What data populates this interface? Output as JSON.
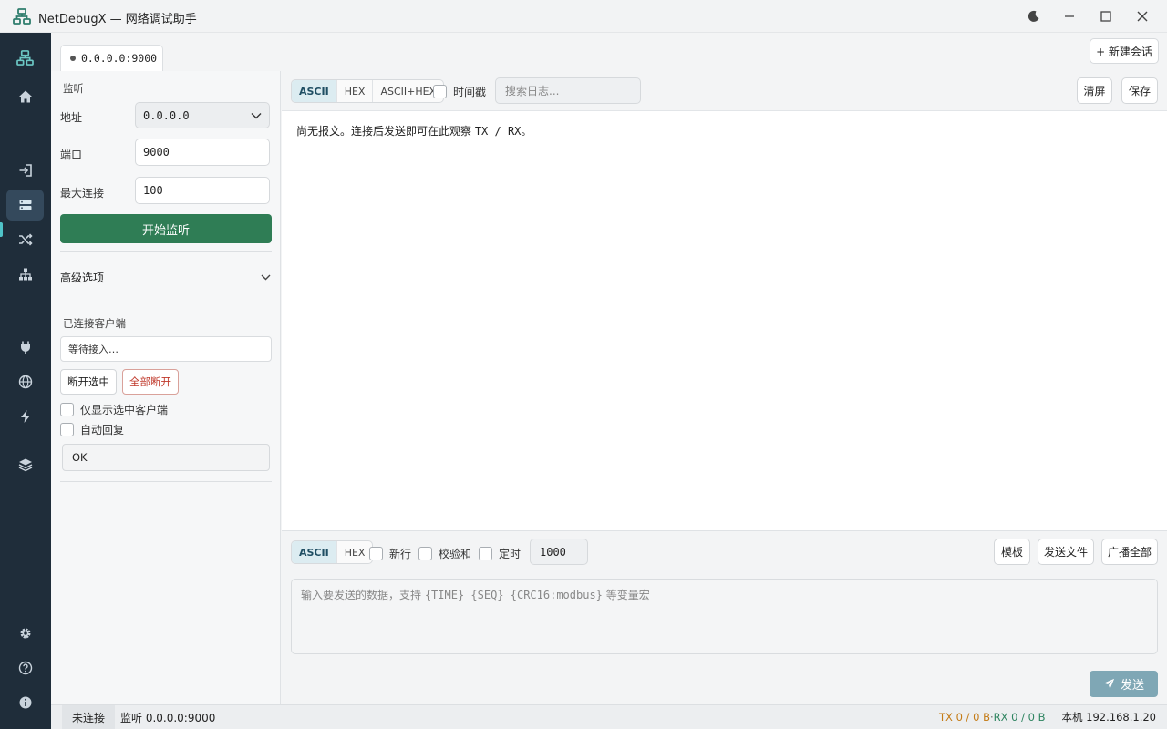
{
  "app": {
    "title": "NetDebugX — 网络调试助手"
  },
  "window_controls": [
    "moon-icon",
    "minimize-icon",
    "maximize-icon",
    "close-icon"
  ],
  "nav": {
    "items": [
      "network-icon",
      "home-icon",
      "login-icon",
      "server-icon",
      "shuffle-icon",
      "sitemap-icon",
      "plug-icon",
      "globe-icon",
      "bolt-icon",
      "layers-icon",
      "gear-icon",
      "help-icon",
      "info-icon"
    ],
    "active": "server-icon"
  },
  "session": {
    "tab_label": "0.0.0.0:9000",
    "new_session_label": "+ 新建会话"
  },
  "config": {
    "section_listen": "监听",
    "address_label": "地址",
    "address_value": "0.0.0.0",
    "port_label": "端口",
    "port_value": "9000",
    "maxconn_label": "最大连接",
    "maxconn_value": "100",
    "start_label": "开始监听",
    "advanced_label": "高级选项",
    "clients_title": "已连接客户端",
    "clients_waiting": "等待接入…",
    "disconnect_selected": "断开选中",
    "disconnect_all": "全部断开",
    "only_selected_label": "仅显示选中客户端",
    "auto_reply_label": "自动回复",
    "auto_reply_value": "OK"
  },
  "log_toolbar": {
    "modes": [
      "ASCII",
      "HEX",
      "ASCII+HEX"
    ],
    "active_mode": "ASCII",
    "timestamp_label": "时间戳",
    "search_placeholder": "搜索日志...",
    "clear_label": "清屏",
    "save_label": "保存"
  },
  "log": {
    "empty_prefix": "尚无报文。连接后发送即可在此观察 ",
    "empty_code": "TX / RX",
    "empty_suffix": "。"
  },
  "send_toolbar": {
    "modes": [
      "ASCII",
      "HEX"
    ],
    "active_mode": "ASCII",
    "newline_label": "新行",
    "checksum_label": "校验和",
    "timer_label": "定时",
    "interval_value": "1000",
    "template_label": "模板",
    "send_file_label": "发送文件",
    "broadcast_label": "广播全部"
  },
  "send": {
    "placeholder_prefix": "输入要发送的数据，支持 ",
    "placeholder_macros": "{TIME} {SEQ} {CRC16:modbus}",
    "placeholder_suffix": " 等变量宏",
    "send_label": "发送"
  },
  "status": {
    "state": "未连接",
    "listen": "监听 0.0.0.0:9000",
    "tx": "TX 0 / 0 B",
    "sep": " · ",
    "rx": "RX 0 / 0 B",
    "local_ip": "本机 192.168.1.20"
  },
  "colors": {
    "accent_green": "#2f7d55",
    "nav_bg": "#1f2d3a",
    "nav_active": "#4fc3c8",
    "danger": "#c0392b",
    "tx": "#c47a14",
    "rx": "#2e8460"
  }
}
